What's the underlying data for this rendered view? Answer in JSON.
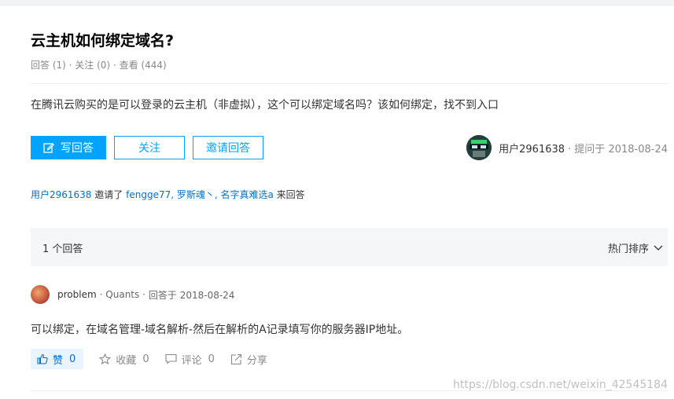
{
  "question": {
    "title": "云主机如何绑定域名?",
    "meta": {
      "answers": "回答 (1)",
      "follows": "关注 (0)",
      "views": "查看 (444)"
    },
    "body": "在腾讯云购买的是可以登录的云主机（非虚拟），这个可以绑定域名吗？该如何绑定，找不到入口"
  },
  "buttons": {
    "write_answer": "写回答",
    "follow": "关注",
    "invite": "邀请回答"
  },
  "asker": {
    "name": "用户2961638",
    "asked": "· 提问于 2018-08-24"
  },
  "invite_line": {
    "inviter": "用户2961638",
    "verb": "邀请了",
    "invitees": "fengge77, 罗斯魂丶, 名字真难选a",
    "suffix": "来回答"
  },
  "answers_bar": {
    "count": "1 个回答",
    "sort": "热门排序"
  },
  "answer": {
    "author": "problem",
    "tag": "· Quants ·",
    "answered": "回答于 2018-08-24",
    "body": "可以绑定，在域名管理-域名解析-然后在解析的A记录填写你的服务器IP地址。",
    "like_label": "赞",
    "like_count": "0",
    "collect_label": "收藏",
    "collect_count": "0",
    "comment_label": "评论",
    "comment_count": "0",
    "share_label": "分享"
  },
  "watermark": "https://blog.csdn.net/weixin_42545184",
  "colors": {
    "accent": "#00a4ff",
    "link": "#0070cc"
  }
}
